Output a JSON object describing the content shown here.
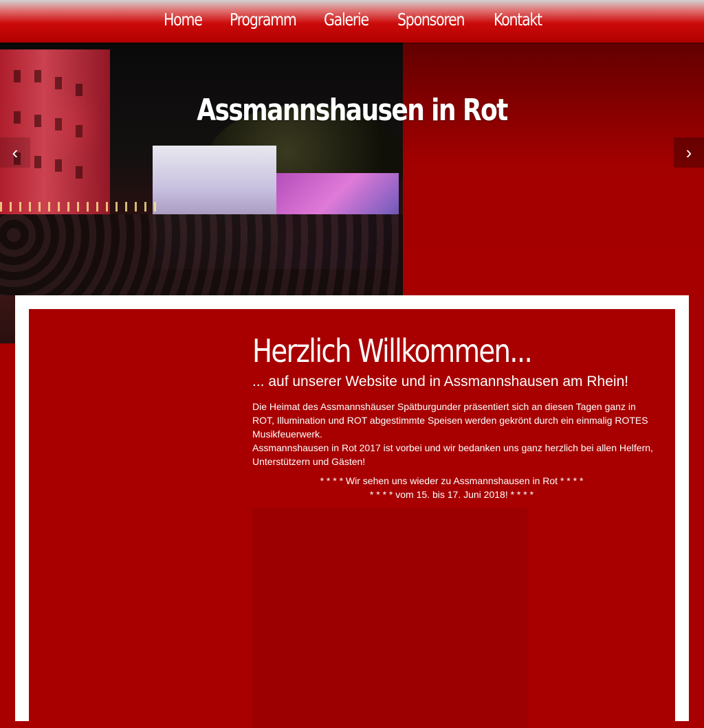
{
  "nav": {
    "items": [
      "Home",
      "Programm",
      "Galerie",
      "Sponsoren",
      "Kontakt"
    ]
  },
  "hero": {
    "title": "Assmannshausen in Rot",
    "prev_icon": "chevron-left-icon",
    "next_icon": "chevron-right-icon",
    "prev_glyph": "‹",
    "next_glyph": "›"
  },
  "welcome": {
    "heading": "Herzlich Willkommen...",
    "subheading": "... auf unserer Website und in Assmannshausen am Rhein!",
    "paragraph1": "Die Heimat des Assmannshäuser Spätburgunder präsentiert sich an diesen Tagen ganz in ROT, Illumination und ROT abgestimmte Speisen werden gekrönt durch ein einmalig ROTES Musikfeuerwerk.",
    "paragraph2": "Assmannshausen in Rot 2017 ist vorbei und wir bedanken uns ganz herzlich bei allen Helfern, Unterstützern und Gästen!",
    "announce1": "* * * * Wir sehen uns wieder zu Assmannshausen in Rot * * * *",
    "announce2": "* * * * vom 15. bis 17. Juni 2018! * * * *"
  },
  "colors": {
    "brand_red": "#a80000",
    "frame": "#ffffff",
    "text": "#ffffff"
  }
}
